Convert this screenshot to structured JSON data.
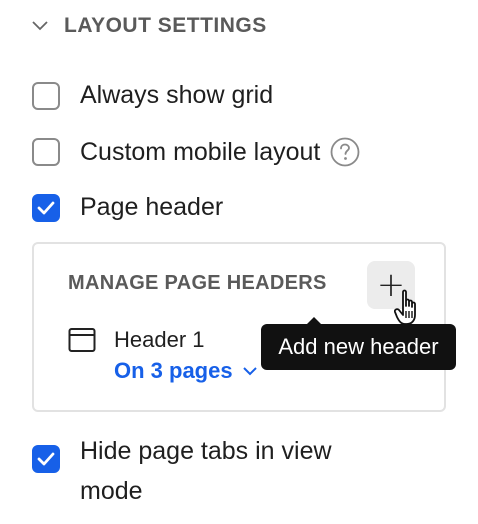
{
  "section": {
    "title": "LAYOUT SETTINGS",
    "chevron_icon": "chevron-down-icon"
  },
  "options": [
    {
      "label": "Always show grid",
      "checked": false
    },
    {
      "label": "Custom mobile layout",
      "checked": false,
      "help_icon": "question-circle-icon"
    },
    {
      "label": "Page header",
      "checked": true
    }
  ],
  "headers_panel": {
    "title": "MANAGE PAGE HEADERS",
    "add_button_icon": "plus-icon",
    "items": [
      {
        "name": "Header 1",
        "pages_label": "On 3 pages",
        "icon": "window-icon"
      }
    ]
  },
  "tooltip": {
    "text": "Add new header"
  },
  "hide_tabs_option": {
    "label": "Hide page tabs in view mode",
    "checked": true
  },
  "colors": {
    "accent": "#1760e8",
    "tooltip_bg": "#111111",
    "panel_border": "#e2e2e2"
  }
}
